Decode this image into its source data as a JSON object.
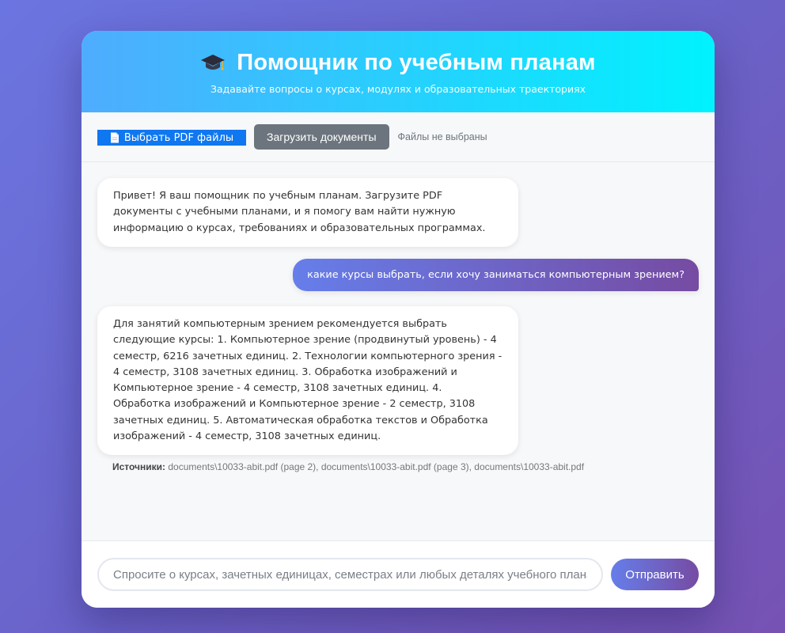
{
  "header": {
    "icon": "graduation-cap-icon",
    "title": "Помощник по учебным планам",
    "subtitle": "Задавайте вопросы о курсах, модулях и образовательных траекториях"
  },
  "upload": {
    "file_button_icon": "document-icon",
    "file_button_label": "Выбрать PDF файлы",
    "load_button_label": "Загрузить документы",
    "status": "Файлы не выбраны"
  },
  "messages": [
    {
      "role": "bot",
      "text": "Привет! Я ваш помощник по учебным планам. Загрузите PDF документы с учебными планами, и я помогу вам найти нужную информацию о курсах, требованиях и образовательных программах."
    },
    {
      "role": "user",
      "text": "какие курсы выбрать, если хочу заниматься компьютерным зрением?"
    },
    {
      "role": "bot",
      "text": "Для занятий компьютерным зрением рекомендуется выбрать следующие курсы: 1. Компьютерное зрение (продвинутый уровень) - 4 семестр, 6216 зачетных единиц. 2. Технологии компьютерного зрения - 4 семестр, 3108 зачетных единиц. 3. Обработка изображений и Компьютерное зрение - 4 семестр, 3108 зачетных единиц. 4. Обработка изображений и Компьютерное зрение - 2 семестр, 3108 зачетных единиц. 5. Автоматическая обработка текстов и Обработка изображений - 4 семестр, 3108 зачетных единиц.",
      "sources_label": "Источники:",
      "sources_text": "documents\\10033-abit.pdf (page 2), documents\\10033-abit.pdf (page 3), documents\\10033-abit.pdf"
    }
  ],
  "input": {
    "placeholder": "Спросите о курсах, зачетных единицах, семестрах или любых деталях учебного плана...",
    "value": "",
    "send_label": "Отправить"
  },
  "colors": {
    "header_gradient_start": "#4facfe",
    "header_gradient_end": "#00f2fe",
    "accent_gradient_start": "#667eea",
    "accent_gradient_end": "#764ba2",
    "file_button": "#0f77f0",
    "load_button": "#6c757d"
  }
}
